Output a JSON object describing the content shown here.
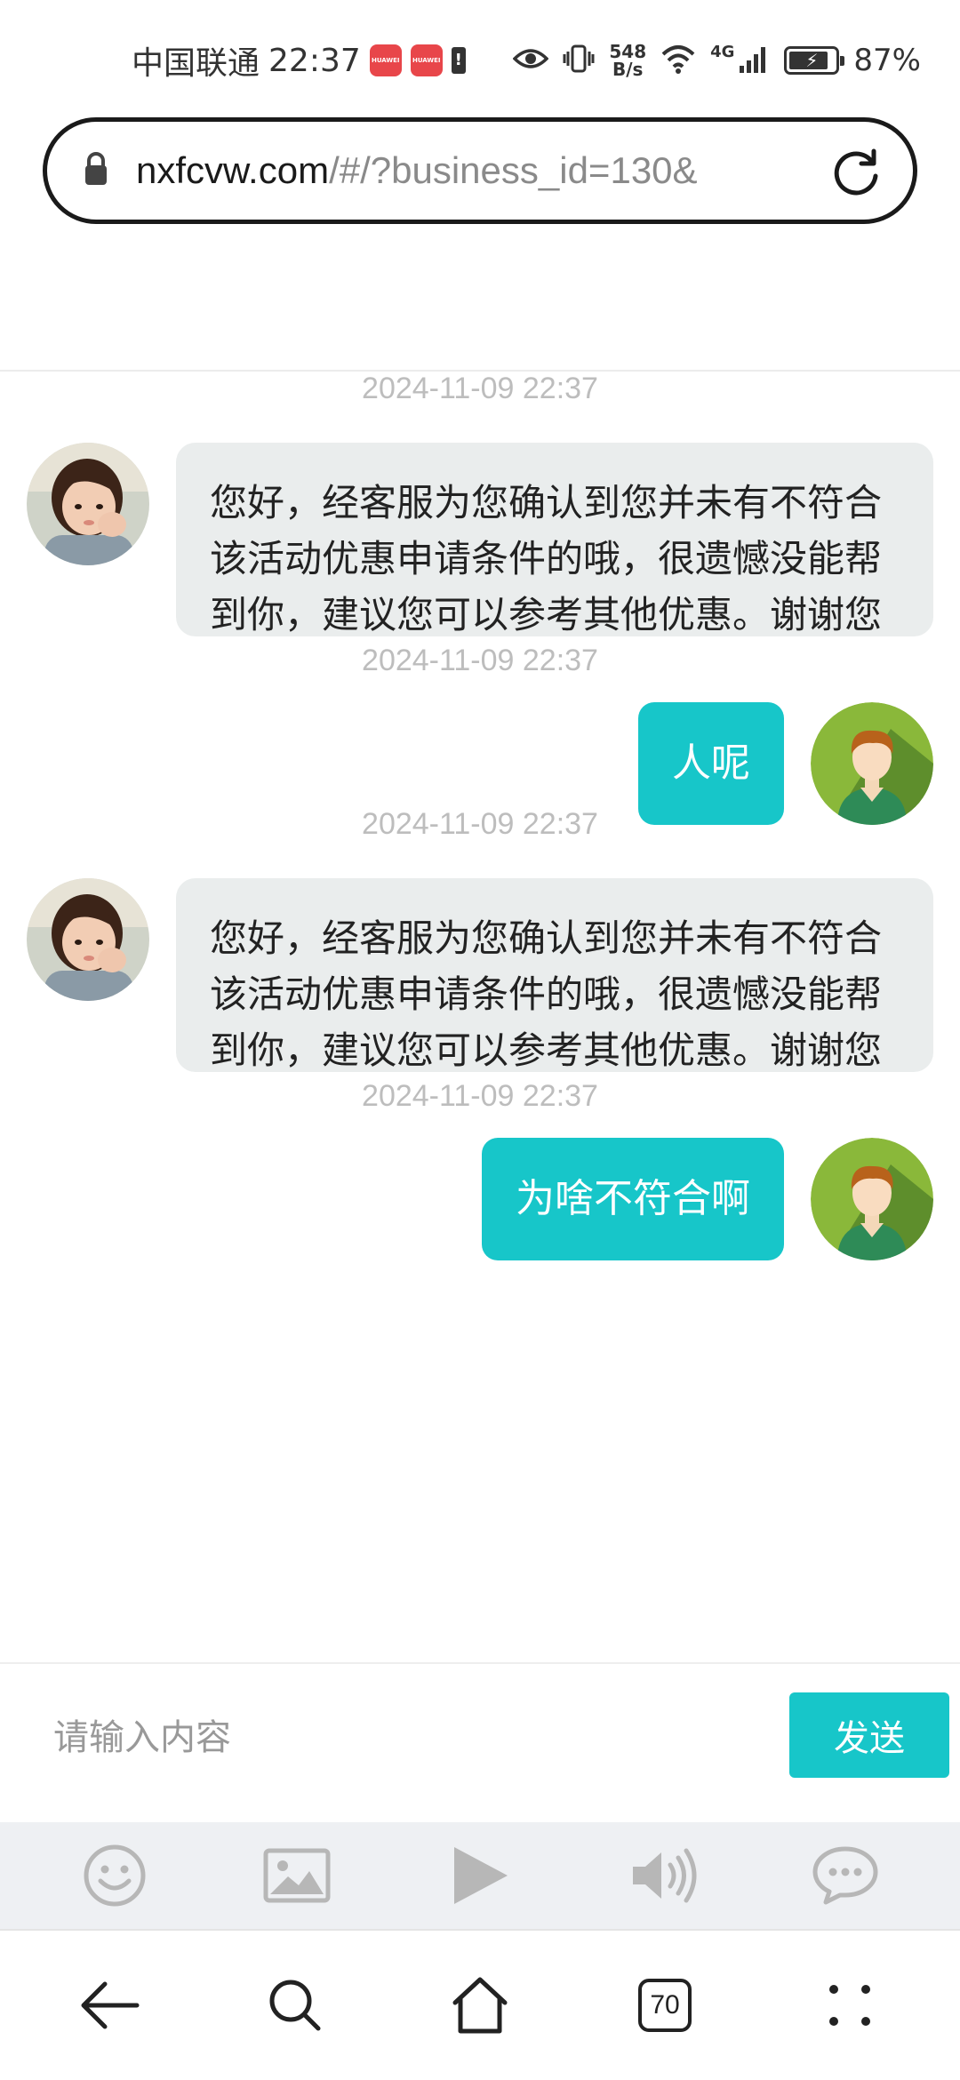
{
  "status_bar": {
    "carrier": "中国联通",
    "time": "22:37",
    "app_badge_text": "HUAWEI",
    "net_speed_value": "548",
    "net_speed_unit": "B/s",
    "signal_type": "4G",
    "battery_level": 0.87,
    "battery_percent": "87%"
  },
  "browser": {
    "url_host": "nxfcvw.com",
    "url_path": "/#/?business_id=130&"
  },
  "chat": {
    "messages": [
      {
        "time": "2024-11-09 22:37",
        "direction": "incoming",
        "text": "您好，经客服为您确认到您并未有不符合该活动优惠申请条件的哦，很遗憾没能帮到你，建议您可以参考其他优惠。谢谢您"
      },
      {
        "time": "2024-11-09 22:37",
        "direction": "outgoing",
        "text": "人呢"
      },
      {
        "time": "2024-11-09 22:37",
        "direction": "incoming",
        "text": "您好，经客服为您确认到您并未有不符合该活动优惠申请条件的哦，很遗憾没能帮到你，建议您可以参考其他优惠。谢谢您"
      },
      {
        "time": "2024-11-09 22:37",
        "direction": "outgoing",
        "text": "为啥不符合啊"
      }
    ]
  },
  "composer": {
    "placeholder": "请输入内容",
    "value": "",
    "send_label": "发送"
  },
  "toolbar": {
    "icons": [
      "emoji-icon",
      "image-icon",
      "video-play-icon",
      "volume-icon",
      "chat-bubble-icon"
    ]
  },
  "nav_bar": {
    "tab_count": "70"
  },
  "colors": {
    "accent": "#17c6c9",
    "incoming_bubble": "#eaeded",
    "timestamp": "#bdbdbd",
    "toolbar_bg": "#eef0f3",
    "icon_gray": "#b7b7b7"
  }
}
